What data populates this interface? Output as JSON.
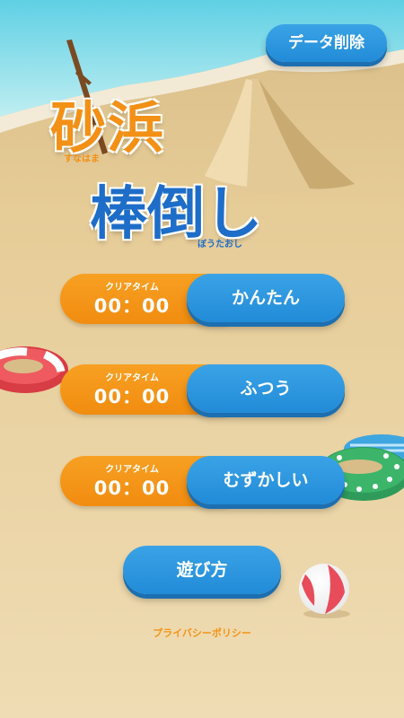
{
  "header": {
    "delete_data_label": "データ削除"
  },
  "title": {
    "line1": "砂浜",
    "line1_reading": "すなはま",
    "line2": "棒倒し",
    "line2_reading": "ぼうたおし"
  },
  "levels": [
    {
      "time_label": "クリアタイム",
      "time": "00：00",
      "button": "かんたん"
    },
    {
      "time_label": "クリアタイム",
      "time": "00：00",
      "button": "ふつう"
    },
    {
      "time_label": "クリアタイム",
      "time": "00：00",
      "button": "むずかしい"
    }
  ],
  "how_to_play_label": "遊び方",
  "privacy_label": "プライバシーポリシー",
  "colors": {
    "orange": "#f39016",
    "blue": "#2a93dc",
    "title_blue": "#1e6dc8",
    "sand": "#e8cc95"
  }
}
